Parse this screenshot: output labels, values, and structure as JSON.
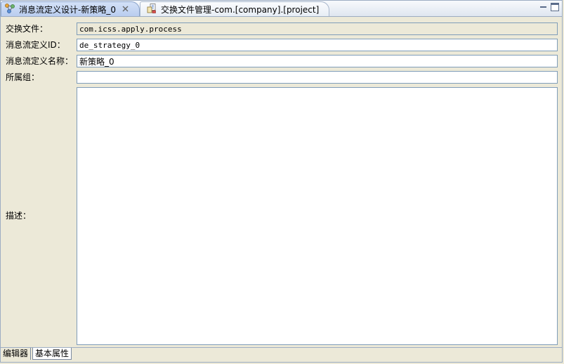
{
  "tabs": [
    {
      "label": "消息流定义设计-新策略_0",
      "active": true,
      "closable": true,
      "icon": "message-flow-icon"
    },
    {
      "label": "交换文件管理-com.[company].[project]",
      "active": false,
      "closable": false,
      "icon": "exchange-file-icon"
    }
  ],
  "form": {
    "exchange_file_label": "交换文件：",
    "exchange_file_value": "com.icss.apply.process",
    "flow_id_label": "消息流定义ID：",
    "flow_id_value": "de_strategy_0",
    "flow_name_label": "消息流定义名称：",
    "flow_name_value": "新策略_0",
    "group_label": "所属组：",
    "group_value": "",
    "description_label": "描述：",
    "description_value": ""
  },
  "bottom_tabs": [
    {
      "label": "编辑器",
      "active": false
    },
    {
      "label": "基本属性",
      "active": true
    }
  ],
  "colors": {
    "background": "#ece9d8",
    "field_border": "#7f9db9",
    "active_tab": "#c6d7f4"
  }
}
